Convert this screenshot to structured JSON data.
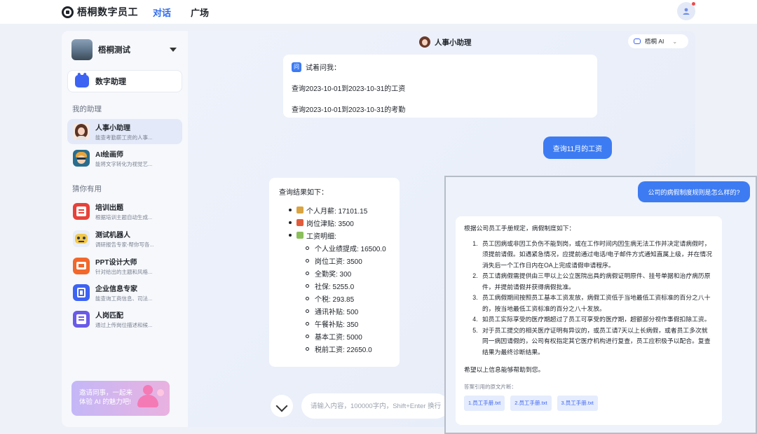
{
  "nav": {
    "brand": "梧桐数字员工",
    "tabs": [
      {
        "label": "对话",
        "active": true
      },
      {
        "label": "广场",
        "active": false
      }
    ],
    "accent": "#2e6bf0"
  },
  "sidebar": {
    "workspace": "梧桐测试",
    "digital_assistant": "数字助理",
    "my_assistants_label": "我的助理",
    "my_assistants": [
      {
        "name": "人事小助理",
        "desc": "能查考勤薪工资的人事...",
        "icon": "hr-avatar-icon",
        "active": true
      },
      {
        "name": "AI绘画师",
        "desc": "能将文字转化为视觉艺...",
        "icon": "painter-avatar-icon",
        "active": false
      }
    ],
    "guess_label": "猜你有用",
    "suggestions": [
      {
        "name": "培训出题",
        "desc": "根据培训主题自动生成...",
        "icon": "exam-icon"
      },
      {
        "name": "测试机器人",
        "desc": "调研报告专家-帮你写各...",
        "icon": "robot-icon"
      },
      {
        "name": "PPT设计大师",
        "desc": "针对给出的主题和风格...",
        "icon": "ppt-icon"
      },
      {
        "name": "企业信息专家",
        "desc": "能查询工商信息、司法...",
        "icon": "enterprise-icon"
      },
      {
        "name": "人岗匹配",
        "desc": "通过上传岗位描述和候...",
        "icon": "cv-icon"
      }
    ],
    "invite_line1": "邀请同事，一起来",
    "invite_line2": "体验 AI 的魅力吧!"
  },
  "chat": {
    "assistant_name": "人事小助理",
    "model": "梧桐 AI",
    "suggest_title": "试着问我：",
    "suggest_badge": "问",
    "suggest_items": [
      "查询2023-10-01到2023-10-31的工资",
      "查询2023-10-01到2023-10-31的考勤"
    ],
    "user_msg": "查询11月的工资",
    "result_title": "查询结果如下：",
    "result_items": [
      {
        "label": "个人月薪: 17101.15",
        "emoji_color": "#d9a441"
      },
      {
        "label": "岗位津贴: 3500",
        "emoji_color": "#e25c3b"
      },
      {
        "label": "工资明细:",
        "emoji_color": "#8bbf5a"
      }
    ],
    "result_details": [
      "个人业绩提成: 16500.0",
      "岗位工资: 3500",
      "全勤奖: 300",
      "社保: 5255.0",
      "个税: 293.85",
      "通讯补贴: 500",
      "午餐补贴: 350",
      "基本工资: 5000",
      "税前工资: 22650.0"
    ],
    "input_placeholder": "请输入内容，100000字内，Shift+Enter 换行"
  },
  "overlay": {
    "question": "公司的病假制度规则是怎么样的?",
    "intro": "根据公司员工手册规定，病假制度如下：",
    "rules": [
      "员工因病或非因工负伤不能到岗，或在工作时间内因生病无法工作并决定请病假时，须提前请假。如遇紧急情况，应提前通过电话/电子邮件方式通知直属上级，并在情况消失后一个工作日内在OA上完成请假申请程序。",
      "员工请病假需提供由三甲以上公立医院出具的病假证明原件、挂号单据和治疗病历原件，并提前请假并获得病假批准。",
      "员工病假期间按照员工基本工资发放，病假工资低于当地最低工资标准的百分之八十的，按当地最低工资标准的百分之八十发放。",
      "如员工实际享受的医疗期超过了员工可享受的医疗期，超额部分视作事假扣除工资。",
      "对于员工提交的相关医疗证明有异议的，或员工请7天以上长病假，或者员工多次就同一病因请假的，公司有权指定其它医疗机构进行复查，员工应积极予以配合。复查结果为最终诊断结果。"
    ],
    "closing": "希望以上信息能够帮助到您。",
    "sources_label": "答案引用的原文片断：",
    "sources": [
      "1.员工手册.txt",
      "2.员工手册.txt",
      "3.员工手册.txt"
    ]
  }
}
